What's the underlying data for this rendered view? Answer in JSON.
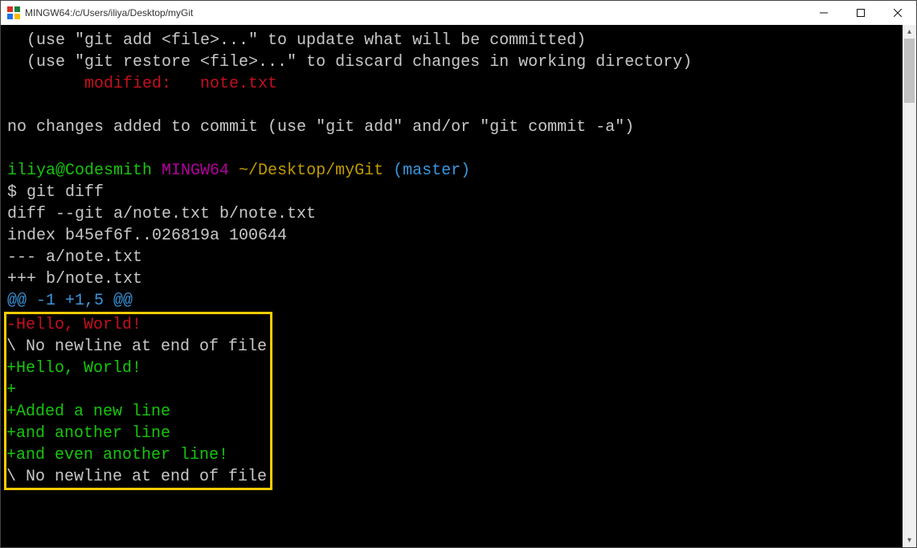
{
  "window": {
    "title": "MINGW64:/c/Users/iliya/Desktop/myGit"
  },
  "terminal": {
    "useAddHint": "  (use \"git add <file>...\" to update what will be committed)",
    "useRestoreHint": "  (use \"git restore <file>...\" to discard changes in working directory)",
    "modifiedIndent": "        ",
    "modifiedLabel": "modified:   note.txt",
    "blank1": "",
    "noChanges": "no changes added to commit (use \"git add\" and/or \"git commit -a\")",
    "blank2": "",
    "promptUser": "iliya@Codesmith",
    "promptEnv": " MINGW64",
    "promptPath": " ~/Desktop/myGit",
    "promptBranch": " (master)",
    "cmd": "$ git diff",
    "diffHeader1": "diff --git a/note.txt b/note.txt",
    "diffHeader2": "index b45ef6f..026819a 100644",
    "diffHeader3": "--- a/note.txt",
    "diffHeader4": "+++ b/note.txt",
    "hunk": "@@ -1 +1,5 @@",
    "removed1": "-Hello, World!",
    "noNewline1": "\\ No newline at end of file",
    "added1": "+Hello, World!",
    "added2": "+",
    "added3": "+Added a new line",
    "added4": "+and another line",
    "added5": "+and even another line!",
    "noNewline2": "\\ No newline at end of file"
  }
}
